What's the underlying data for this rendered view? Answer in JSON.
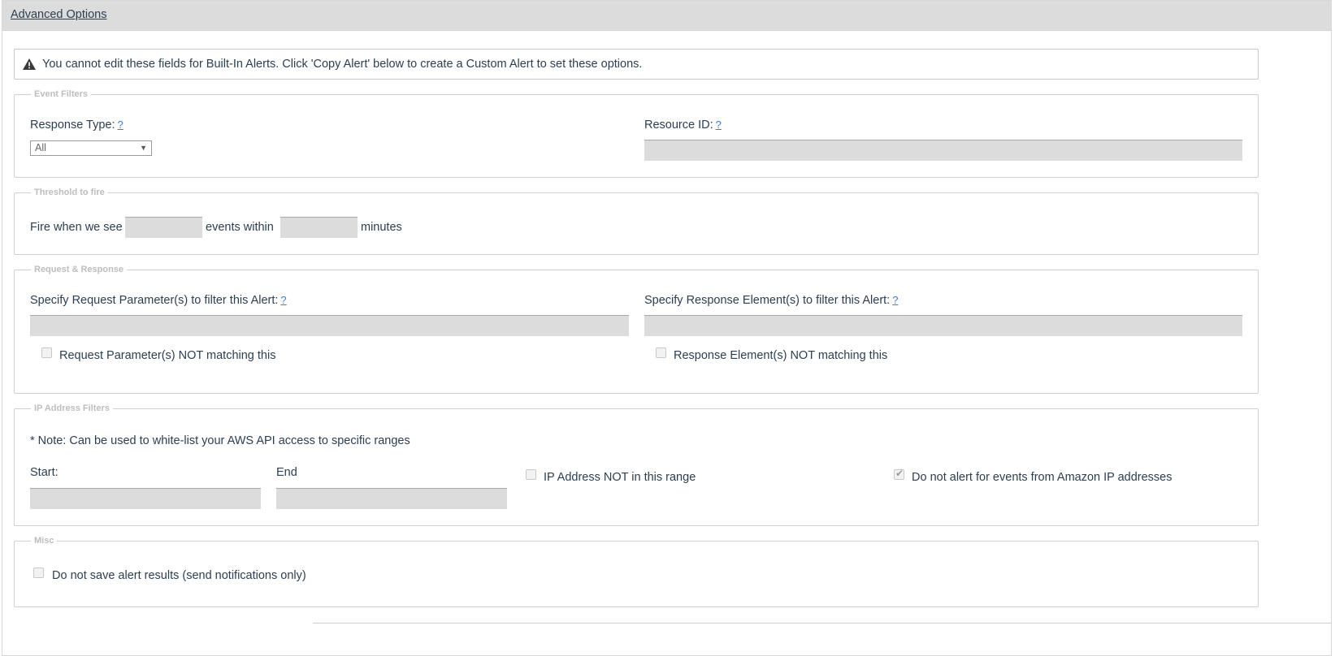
{
  "panel": {
    "title": "Advanced Options"
  },
  "warning": {
    "icon": "warning-triangle-icon",
    "text": "You cannot edit these fields for Built-In Alerts. Click 'Copy Alert' below to create a Custom Alert to set these options."
  },
  "event_filters": {
    "legend": "Event Filters",
    "response_type_label": "Response Type:",
    "response_type_help": "?",
    "response_type_value": "All",
    "resource_id_label": "Resource ID:",
    "resource_id_help": "?",
    "resource_id_value": ""
  },
  "threshold": {
    "legend": "Threshold to fire",
    "prefix": "Fire when we see",
    "events_value": "",
    "middle": "events within",
    "minutes_value": "",
    "suffix": "minutes"
  },
  "request_response": {
    "legend": "Request & Response",
    "request_label": "Specify Request Parameter(s) to filter this Alert:",
    "request_help": "?",
    "request_value": "",
    "request_not_label": "Request Parameter(s) NOT matching this",
    "request_not_checked": false,
    "response_label": "Specify Response Element(s) to filter this Alert:",
    "response_help": "?",
    "response_value": "",
    "response_not_label": "Response Element(s) NOT matching this",
    "response_not_checked": false
  },
  "ip_filters": {
    "legend": "IP Address Filters",
    "note": "* Note: Can be used to white-list your AWS API access to specific ranges",
    "start_label": "Start:",
    "start_value": "",
    "end_label": "End",
    "end_value": "",
    "not_in_range_label": "IP Address NOT in this range",
    "not_in_range_checked": false,
    "no_amazon_label": "Do not alert for events from Amazon IP addresses",
    "no_amazon_checked": true
  },
  "misc": {
    "legend": "Misc",
    "no_save_label": "Do not save alert results (send notifications only)",
    "no_save_checked": false
  },
  "colors": {
    "header_bg": "#dcdcdc",
    "field_bg": "#dcdcdc",
    "text": "#2c3e50",
    "link": "#3b7dd8",
    "legend": "#bdbdbd"
  }
}
